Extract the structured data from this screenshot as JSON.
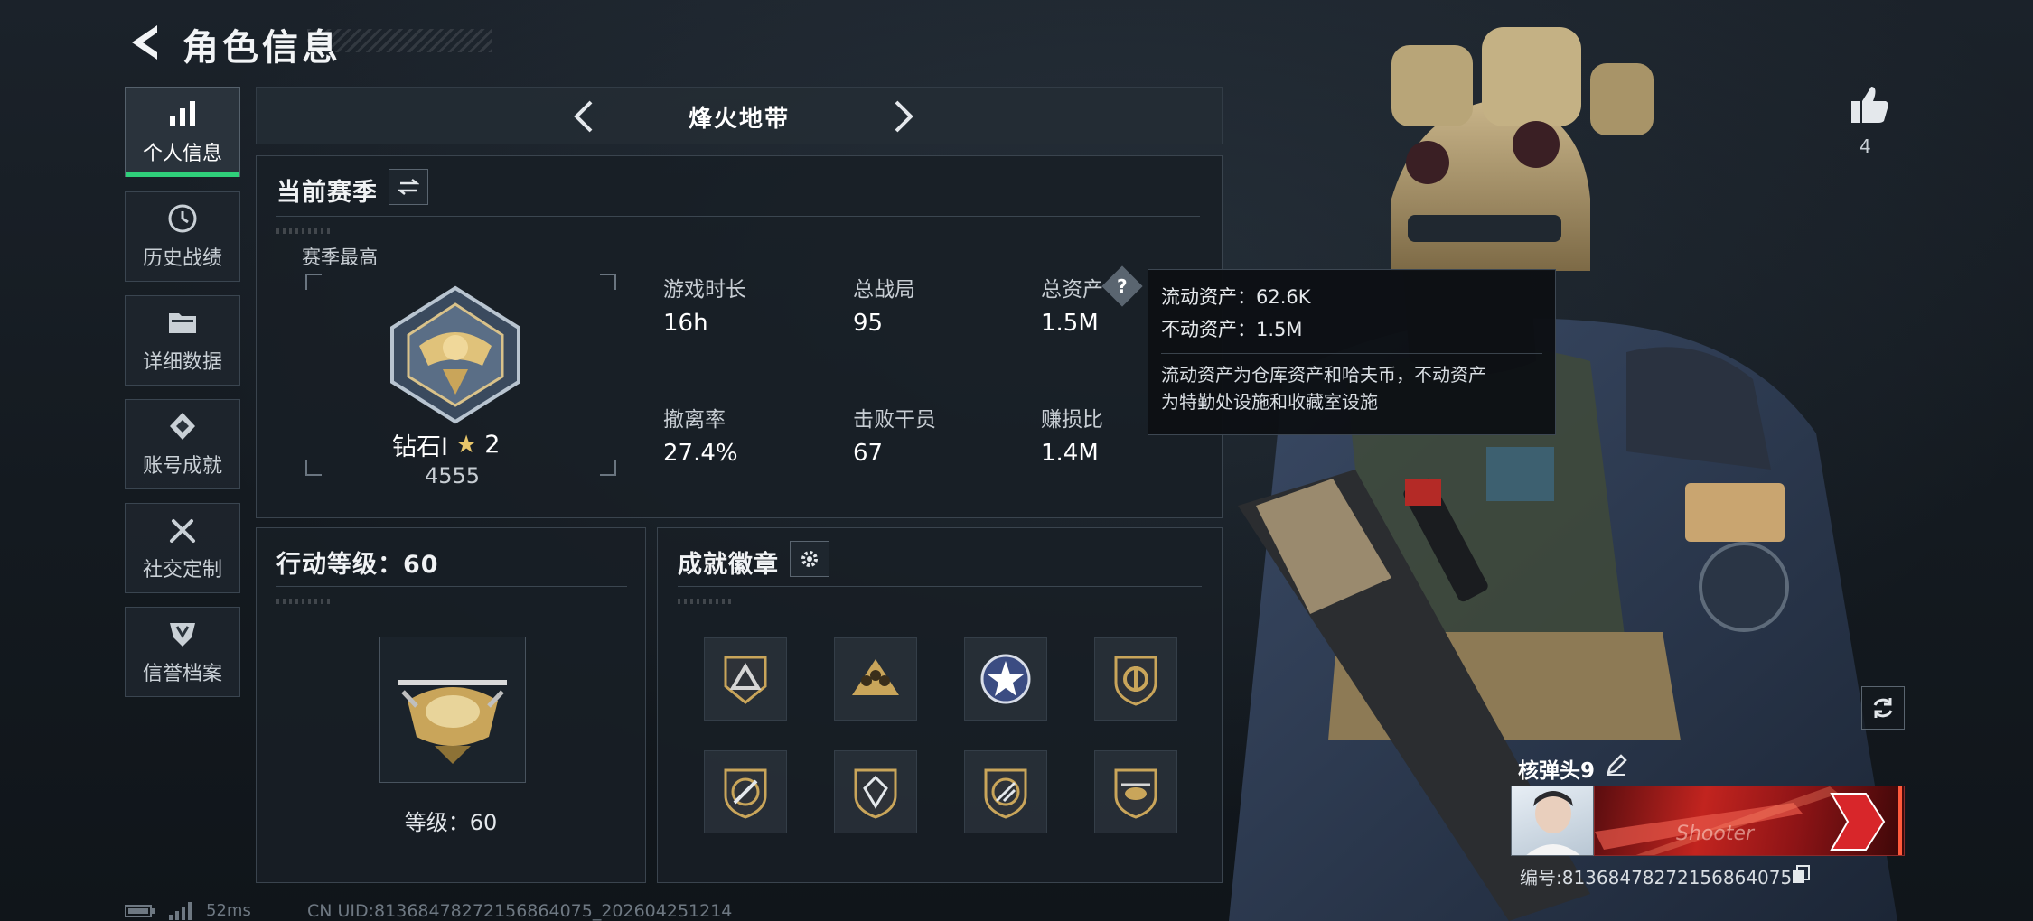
{
  "header": {
    "title": "角色信息"
  },
  "sidebar": {
    "items": [
      {
        "label": "个人信息",
        "icon": "bar-chart-icon",
        "active": true
      },
      {
        "label": "历史战绩",
        "icon": "history-clock-icon"
      },
      {
        "label": "详细数据",
        "icon": "folder-icon"
      },
      {
        "label": "账号成就",
        "icon": "achievement-diamond-icon"
      },
      {
        "label": "社交定制",
        "icon": "wrench-screwdriver-icon"
      },
      {
        "label": "信誉档案",
        "icon": "shield-emblem-icon"
      }
    ]
  },
  "mode_selector": {
    "title": "烽火地带"
  },
  "season": {
    "title": "当前赛季",
    "best_label": "赛季最高",
    "rank_name": "钻石I",
    "rank_stars": "2",
    "rank_score": "4555",
    "stats": [
      {
        "label": "游戏时长",
        "value": "16h"
      },
      {
        "label": "总战局",
        "value": "95"
      },
      {
        "label": "总资产",
        "value": "1.5M"
      },
      {
        "label": "撤离率",
        "value": "27.4%"
      },
      {
        "label": "击败干员",
        "value": "67"
      },
      {
        "label": "赚损比",
        "value": "1.4M"
      }
    ]
  },
  "tooltip": {
    "line1": "流动资产：62.6K",
    "line2": "不动资产：1.5M",
    "desc1": "流动资产为仓库资产和哈夫币，不动资产",
    "desc2": "为特勤处设施和收藏室设施"
  },
  "action_level": {
    "title": "行动等级：60",
    "level_text": "等级：60"
  },
  "badges": {
    "title": "成就徽章",
    "items": [
      "badge-triangle",
      "badge-squad",
      "badge-star",
      "badge-shield",
      "badge-knife",
      "badge-gem",
      "badge-knife-2",
      "badge-heli"
    ]
  },
  "profile": {
    "likes": "4",
    "name": "核弹头9",
    "uid_line": "编号:81368478272156864075",
    "namecard_text": "Shooter"
  },
  "footer": {
    "ping": "52ms",
    "cn_uid": "CN UID:81368478272156864075_202604251214"
  },
  "colors": {
    "accent_green": "#2fcf7a",
    "gold": "#c9a55a",
    "panel_bg": "#181f26"
  }
}
